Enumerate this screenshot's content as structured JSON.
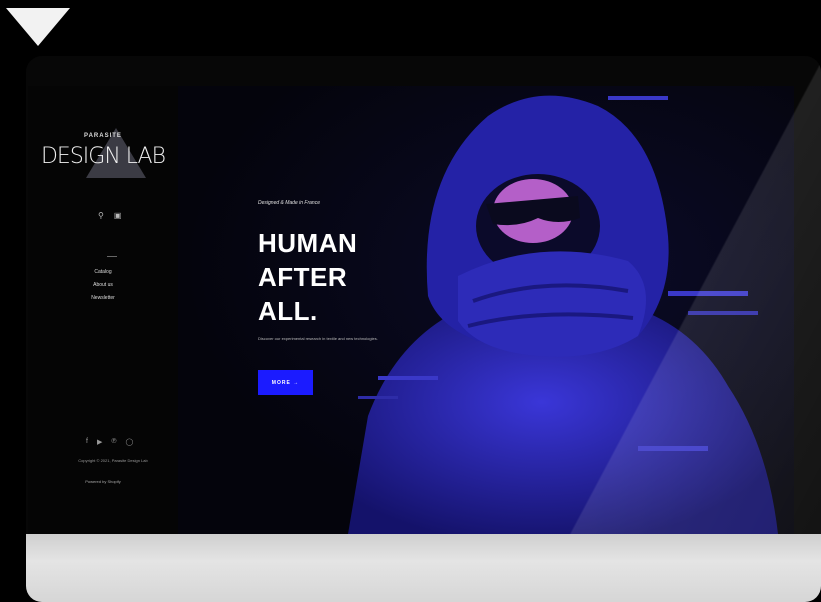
{
  "sidebar": {
    "logo_small": "PARASITE",
    "logo_big": "DESIGN LAB",
    "icons": [
      "search-icon",
      "cart-icon"
    ],
    "nav": [
      "Catalog",
      "About us",
      "Newsletter"
    ],
    "social_icons": [
      "facebook-icon",
      "youtube-icon",
      "pinterest-icon",
      "instagram-icon"
    ],
    "copyright": "Copyright © 2021, Parasite Design Lab",
    "powered": "Powered by Shopify"
  },
  "hero": {
    "kicker": "Designed & Made in France",
    "title_lines": [
      "HUMAN",
      "AFTER",
      "ALL."
    ],
    "description": "Discover our experimental research in textile and new technologies.",
    "button_label": "MORE  →"
  },
  "colors": {
    "accent": "#1b1bff",
    "figure": "#2a27b8",
    "background": "#060610"
  }
}
